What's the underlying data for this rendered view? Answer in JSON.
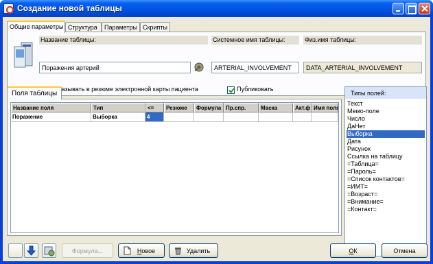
{
  "window": {
    "title": "Создание новой таблицы"
  },
  "top_tabs": [
    "Общие параметры",
    "Структура",
    "Параметры",
    "Скрипты"
  ],
  "general": {
    "table_name_label": "Название таблицы:",
    "table_name_value": "Поражения артерий",
    "system_name_label": "Системное имя таблицы:",
    "system_name_value": "ARTERIAL_INVOLVEMENT",
    "phys_name_label": "Физ.имя таблицы:",
    "phys_name_value": "DATA_ARTERIAL_INVOLVEMENT",
    "show_in_summary_label": "Показывать в резюме электронной карты пациента",
    "show_in_summary_checked": true,
    "publish_label": "Публиковать",
    "publish_checked": true
  },
  "fields_tab": {
    "label": "Поля таблицы"
  },
  "grid": {
    "columns": [
      "Название поля",
      "Тип",
      "<=",
      "Резюме",
      "Формула",
      "Пр.спр.",
      "Маска",
      "Акт.ф",
      "Имя поля"
    ],
    "rows": [
      {
        "name": "Поражение",
        "type": "Выборка",
        "le": "4",
        "summary": "",
        "formula": "",
        "ref": "",
        "mask": "",
        "act": "",
        "field_name": ""
      }
    ]
  },
  "types_panel": {
    "title": "Типы полей:",
    "items": [
      "Текст",
      "Мемо-поле",
      "Число",
      "ДаНет",
      "Выборка",
      "Дата",
      "Рисунок",
      "Ссылка на таблицу",
      "=Таблица=",
      "=Пароль=",
      "=Список контактов=",
      "=ИМТ=",
      "=Возраст=",
      "=Внимание=",
      "=Контакт="
    ],
    "selected": "Выборка"
  },
  "buttons": {
    "formula": "Формула...",
    "new_prefix": "Н",
    "new_rest": "овое",
    "delete": "Удалить",
    "ok_prefix": "О",
    "ok_rest": "К",
    "cancel": "Отмена"
  }
}
